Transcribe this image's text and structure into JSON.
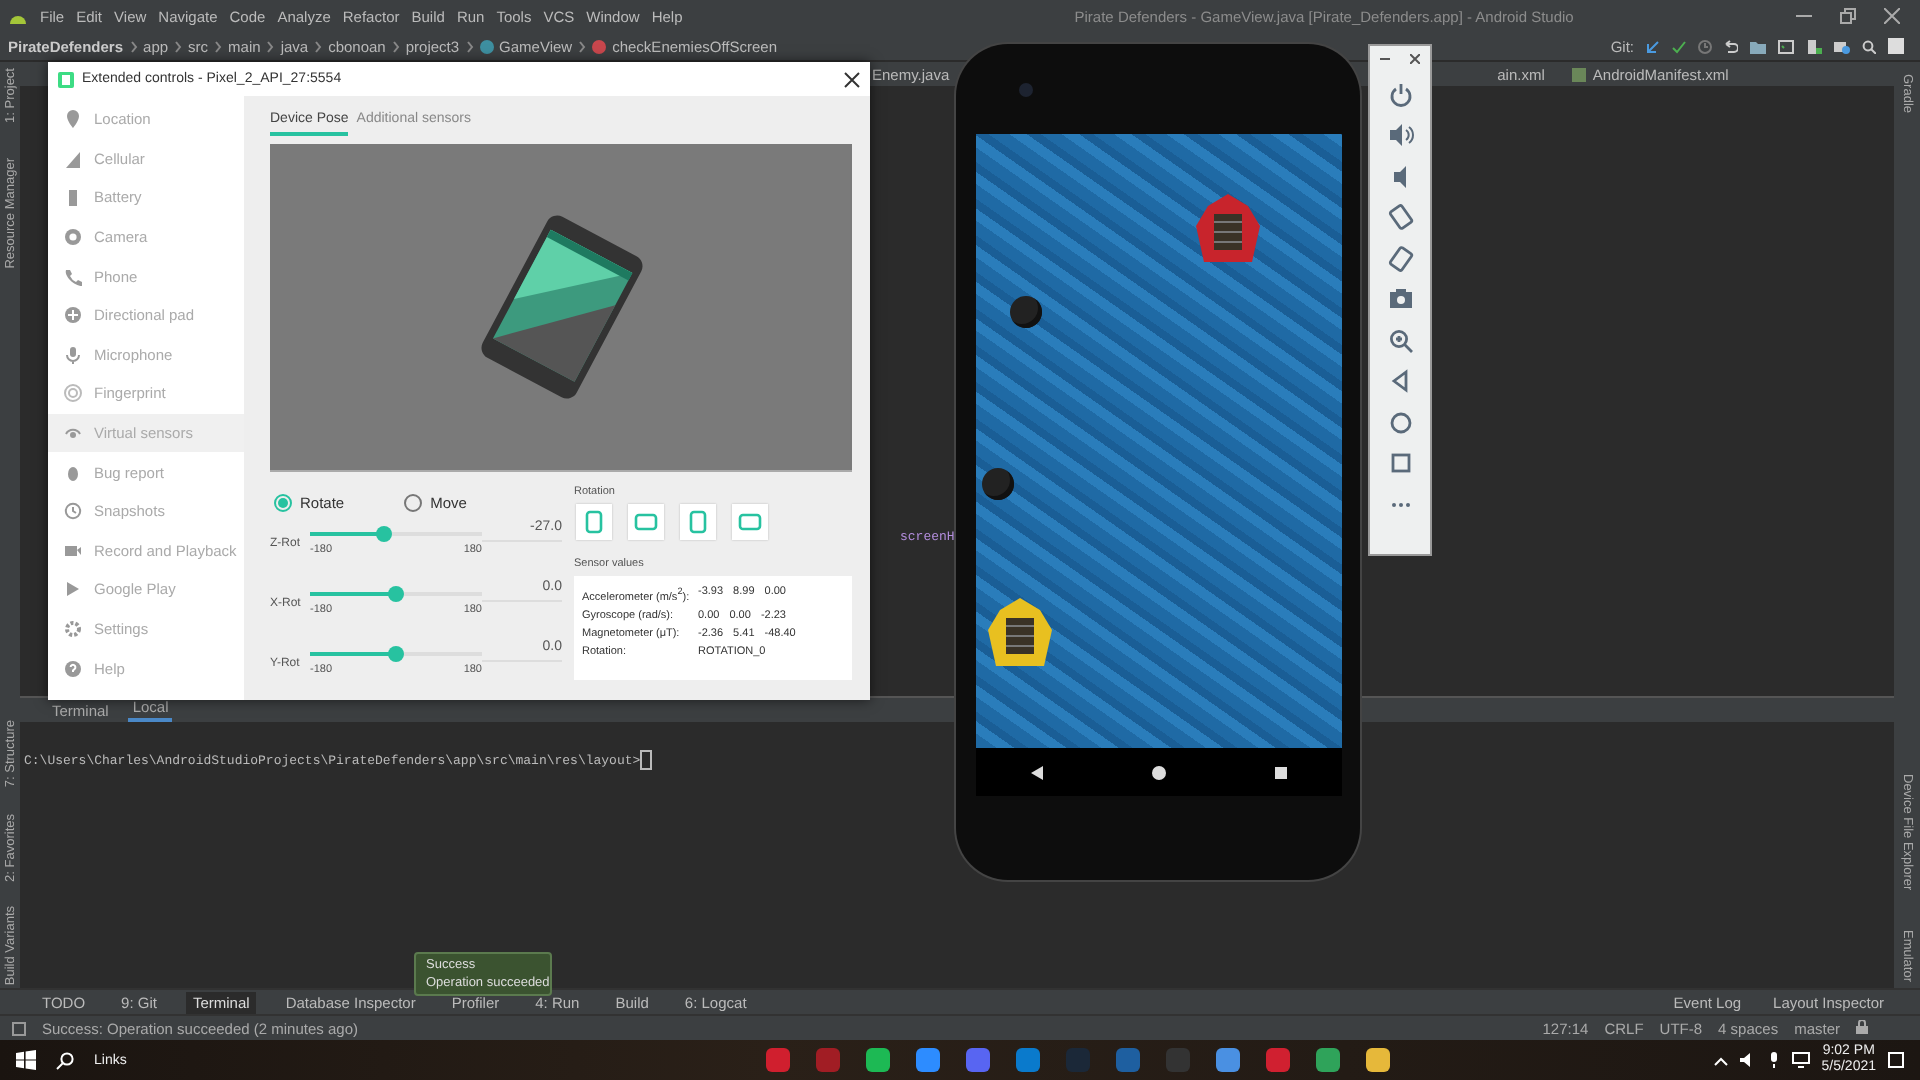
{
  "ide": {
    "menu": [
      "File",
      "Edit",
      "View",
      "Navigate",
      "Code",
      "Analyze",
      "Refactor",
      "Build",
      "Run",
      "Tools",
      "VCS",
      "Window",
      "Help"
    ],
    "title": "Pirate Defenders - GameView.java [Pirate_Defenders.app] - Android Studio",
    "breadcrumbs": [
      "PirateDefenders",
      "app",
      "src",
      "main",
      "java",
      "cbonoan",
      "project3",
      "GameView",
      "checkEnemiesOffScreen"
    ],
    "git_label": "Git:",
    "left_tools": [
      "1: Project",
      "Resource Manager",
      "7: Structure",
      "2: Favorites",
      "Build Variants"
    ],
    "right_tools": [
      "Gradle",
      "Device File Explorer",
      "Emulator"
    ],
    "editor_tabs": [
      "Enemy.java",
      "ain.xml",
      "AndroidManifest.xml"
    ],
    "editor_text": "screenH",
    "terminal": {
      "tabs": [
        {
          "label": "Terminal",
          "selected": false
        },
        {
          "label": "Local",
          "selected": true
        }
      ],
      "prompt": "C:\\Users\\Charles\\AndroidStudioProjects\\PirateDefenders\\app\\src\\main\\res\\layout>"
    },
    "bottom_tools": [
      {
        "label": "TODO",
        "selected": false
      },
      {
        "label": "9: Git",
        "selected": false
      },
      {
        "label": "Terminal",
        "selected": true
      },
      {
        "label": "Database Inspector",
        "selected": false
      },
      {
        "label": "Profiler",
        "selected": false
      },
      {
        "label": "4: Run",
        "selected": false
      },
      {
        "label": "Build",
        "selected": false
      },
      {
        "label": "6: Logcat",
        "selected": false
      }
    ],
    "bottom_tools_right": [
      "Event Log",
      "Layout Inspector"
    ],
    "status": {
      "message": "Success: Operation succeeded (2 minutes ago)",
      "items": [
        "127:14",
        "CRLF",
        "UTF-8",
        "4 spaces",
        "master"
      ]
    }
  },
  "extended_controls": {
    "title": "Extended controls - Pixel_2_API_27:5554",
    "nav": [
      {
        "label": "Location",
        "selected": false
      },
      {
        "label": "Cellular",
        "selected": false
      },
      {
        "label": "Battery",
        "selected": false
      },
      {
        "label": "Camera",
        "selected": false
      },
      {
        "label": "Phone",
        "selected": false
      },
      {
        "label": "Directional pad",
        "selected": false
      },
      {
        "label": "Microphone",
        "selected": false
      },
      {
        "label": "Fingerprint",
        "selected": false
      },
      {
        "label": "Virtual sensors",
        "selected": true
      },
      {
        "label": "Bug report",
        "selected": false
      },
      {
        "label": "Snapshots",
        "selected": false
      },
      {
        "label": "Record and Playback",
        "selected": false
      },
      {
        "label": "Google Play",
        "selected": false
      },
      {
        "label": "Settings",
        "selected": false
      },
      {
        "label": "Help",
        "selected": false
      }
    ],
    "tabs": [
      {
        "label": "Device Pose",
        "selected": true
      },
      {
        "label": "Additional sensors",
        "selected": false
      }
    ],
    "mode": [
      {
        "label": "Rotate",
        "selected": true
      },
      {
        "label": "Move",
        "selected": false
      }
    ],
    "sliders": [
      {
        "label": "Z-Rot",
        "min": "-180",
        "max": "180",
        "reading": "-27.0",
        "level": 0.425
      },
      {
        "label": "X-Rot",
        "min": "-180",
        "max": "180",
        "reading": "0.0",
        "level": 0.5
      },
      {
        "label": "Y-Rot",
        "min": "-180",
        "max": "180",
        "reading": "0.0",
        "level": 0.5
      }
    ],
    "rotation_title": "Rotation",
    "sensor_title": "Sensor values",
    "sensors": [
      {
        "name": "Accelerometer (m/s$^{2}$):",
        "values": [
          "-3.93",
          "8.99",
          "0.00"
        ]
      },
      {
        "name": "Gyroscope (rad/s):",
        "values": [
          "0.00",
          "0.00",
          "-2.23"
        ]
      },
      {
        "name": "Magnetometer (μT):",
        "values": [
          "-2.36",
          "5.41",
          "-48.40"
        ]
      },
      {
        "name": "Rotation:",
        "values": [
          "ROTATION_0"
        ]
      }
    ]
  },
  "toast": {
    "title": "Success",
    "message": "Operation succeeded"
  },
  "taskbar": {
    "search": "Links",
    "time": "9:02 PM",
    "date": "5/5/2021"
  }
}
